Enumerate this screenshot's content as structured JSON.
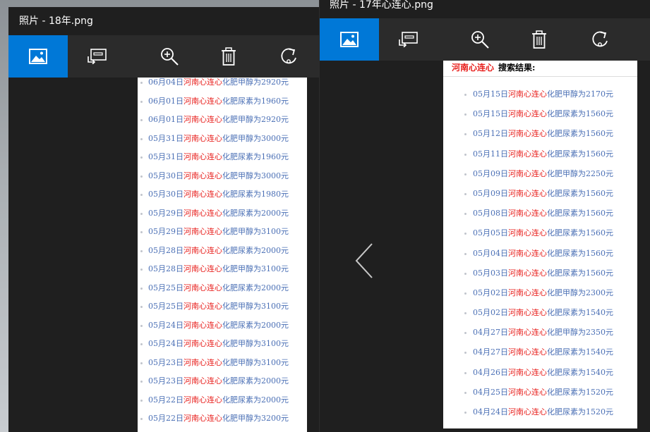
{
  "window_left": {
    "title": "照片 - 18年.png",
    "toolbar": {
      "image_button": "view-image",
      "slideshow_button": "slideshow",
      "zoom_button": "zoom-in",
      "delete_button": "delete",
      "rotate_button": "rotate"
    },
    "items": [
      {
        "pre": "06月04日",
        "kw": "河南心连心",
        "post": "化肥甲醇为2920元"
      },
      {
        "pre": "06月01日",
        "kw": "河南心连心",
        "post": "化肥尿素为1960元"
      },
      {
        "pre": "06月01日",
        "kw": "河南心连心",
        "post": "化肥甲醇为2920元"
      },
      {
        "pre": "05月31日",
        "kw": "河南心连心",
        "post": "化肥甲醇为3000元"
      },
      {
        "pre": "05月31日",
        "kw": "河南心连心",
        "post": "化肥尿素为1960元"
      },
      {
        "pre": "05月30日",
        "kw": "河南心连心",
        "post": "化肥甲醇为3000元"
      },
      {
        "pre": "05月30日",
        "kw": "河南心连心",
        "post": "化肥尿素为1980元"
      },
      {
        "pre": "05月29日",
        "kw": "河南心连心",
        "post": "化肥尿素为2000元"
      },
      {
        "pre": "05月29日",
        "kw": "河南心连心",
        "post": "化肥甲醇为3100元"
      },
      {
        "pre": "05月28日",
        "kw": "河南心连心",
        "post": "化肥尿素为2000元"
      },
      {
        "pre": "05月28日",
        "kw": "河南心连心",
        "post": "化肥甲醇为3100元"
      },
      {
        "pre": "05月25日",
        "kw": "河南心连心",
        "post": "化肥尿素为2000元"
      },
      {
        "pre": "05月25日",
        "kw": "河南心连心",
        "post": "化肥甲醇为3100元"
      },
      {
        "pre": "05月24日",
        "kw": "河南心连心",
        "post": "化肥尿素为2000元"
      },
      {
        "pre": "05月24日",
        "kw": "河南心连心",
        "post": "化肥甲醇为3100元"
      },
      {
        "pre": "05月23日",
        "kw": "河南心连心",
        "post": "化肥甲醇为3100元"
      },
      {
        "pre": "05月23日",
        "kw": "河南心连心",
        "post": "化肥尿素为2000元"
      },
      {
        "pre": "05月22日",
        "kw": "河南心连心",
        "post": "化肥尿素为2000元"
      },
      {
        "pre": "05月22日",
        "kw": "河南心连心",
        "post": "化肥甲醇为3200元"
      }
    ]
  },
  "window_right": {
    "title": "照片 - 17年心连心.png",
    "toolbar": {
      "image_button": "view-image",
      "slideshow_button": "slideshow",
      "zoom_button": "zoom-in",
      "delete_button": "delete",
      "rotate_button": "rotate"
    },
    "header": {
      "kw": "河南心连心",
      "rest": "搜索结果:"
    },
    "items": [
      {
        "pre": "05月15日",
        "kw": "河南心连心",
        "post": "化肥甲醇为2170元"
      },
      {
        "pre": "05月15日",
        "kw": "河南心连心",
        "post": "化肥尿素为1560元"
      },
      {
        "pre": "05月12日",
        "kw": "河南心连心",
        "post": "化肥尿素为1560元"
      },
      {
        "pre": "05月11日",
        "kw": "河南心连心",
        "post": "化肥尿素为1560元"
      },
      {
        "pre": "05月09日",
        "kw": "河南心连心",
        "post": "化肥甲醇为2250元"
      },
      {
        "pre": "05月09日",
        "kw": "河南心连心",
        "post": "化肥尿素为1560元"
      },
      {
        "pre": "05月08日",
        "kw": "河南心连心",
        "post": "化肥尿素为1560元"
      },
      {
        "pre": "05月05日",
        "kw": "河南心连心",
        "post": "化肥尿素为1560元"
      },
      {
        "pre": "05月04日",
        "kw": "河南心连心",
        "post": "化肥尿素为1560元"
      },
      {
        "pre": "05月03日",
        "kw": "河南心连心",
        "post": "化肥尿素为1560元"
      },
      {
        "pre": "05月02日",
        "kw": "河南心连心",
        "post": "化肥甲醇为2300元"
      },
      {
        "pre": "05月02日",
        "kw": "河南心连心",
        "post": "化肥尿素为1540元"
      },
      {
        "pre": "04月27日",
        "kw": "河南心连心",
        "post": "化肥甲醇为2350元"
      },
      {
        "pre": "04月27日",
        "kw": "河南心连心",
        "post": "化肥尿素为1540元"
      },
      {
        "pre": "04月26日",
        "kw": "河南心连心",
        "post": "化肥尿素为1540元"
      },
      {
        "pre": "04月25日",
        "kw": "河南心连心",
        "post": "化肥尿素为1520元"
      },
      {
        "pre": "04月24日",
        "kw": "河南心连心",
        "post": "化肥尿素为1520元"
      }
    ],
    "prev_button": "previous"
  },
  "colors": {
    "accent": "#0078d7",
    "keyword_red": "#e8201d",
    "link_blue": "#4a6fb5",
    "titlebar": "#1f1f1f",
    "toolbar": "#2b2b2b"
  }
}
